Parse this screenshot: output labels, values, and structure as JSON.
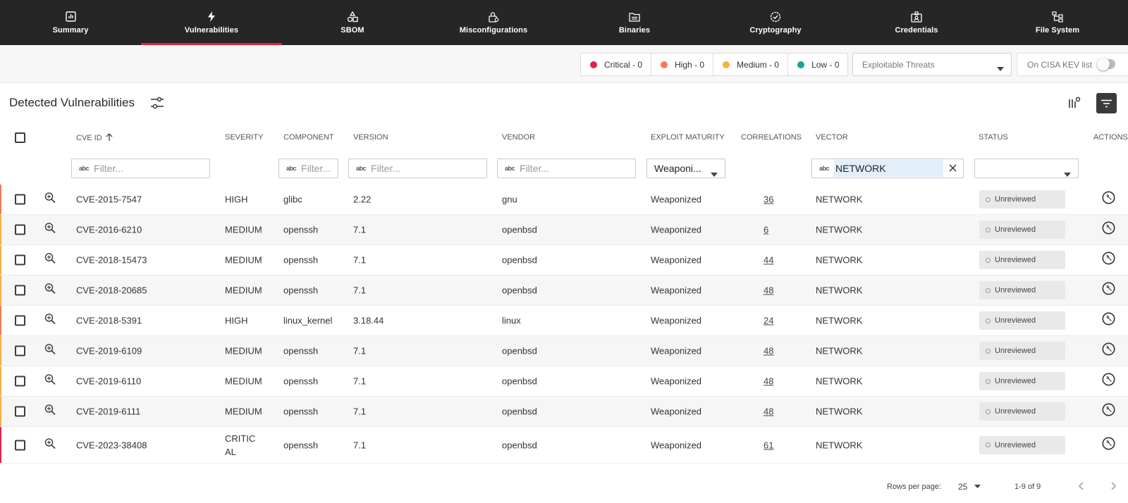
{
  "nav": {
    "tabs": [
      {
        "label": "Summary",
        "icon": "bar-chart-icon",
        "active": false
      },
      {
        "label": "Vulnerabilities",
        "icon": "lightning-icon",
        "active": true
      },
      {
        "label": "SBOM",
        "icon": "shapes-icon",
        "active": false
      },
      {
        "label": "Misconfigurations",
        "icon": "lock-gear-icon",
        "active": false
      },
      {
        "label": "Binaries",
        "icon": "folder-icon",
        "active": false
      },
      {
        "label": "Cryptography",
        "icon": "check-badge-icon",
        "active": false
      },
      {
        "label": "Credentials",
        "icon": "id-card-icon",
        "active": false
      },
      {
        "label": "File System",
        "icon": "tree-icon",
        "active": false
      }
    ],
    "accent_color": "#e8202e"
  },
  "toolbar": {
    "severity": [
      {
        "label": "Critical - 0",
        "color": "#e0234e"
      },
      {
        "label": "High - 0",
        "color": "#f47a5a"
      },
      {
        "label": "Medium - 0",
        "color": "#f6b03e"
      },
      {
        "label": "Low - 0",
        "color": "#17a39a"
      }
    ],
    "threats_placeholder": "Exploitable Threats",
    "kev_label": "On CISA KEV list"
  },
  "section": {
    "title": "Detected Vulnerabilities"
  },
  "table": {
    "headers": {
      "cve_id": "CVE ID",
      "severity": "SEVERITY",
      "component": "COMPONENT",
      "version": "VERSION",
      "vendor": "VENDOR",
      "exploit_maturity": "EXPLOIT MATURITY",
      "correlations": "CORRELATIONS",
      "vector": "VECTOR",
      "status": "STATUS",
      "actions": "ACTIONS"
    },
    "filters": {
      "placeholder": "Filter...",
      "component_placeholder": "Filter...",
      "abc_glyph": "abc",
      "exploit_maturity_value": "Weaponi...",
      "vector_value": "NETWORK",
      "status_value": ""
    },
    "rows": [
      {
        "cve": "CVE-2015-7547",
        "severity": "HIGH",
        "component": "glibc",
        "version": "2.22",
        "vendor": "gnu",
        "exploit": "Weaponized",
        "correlations": "36",
        "vector": "NETWORK",
        "status": "Unreviewed",
        "bar": "#f47a5a"
      },
      {
        "cve": "CVE-2016-6210",
        "severity": "MEDIUM",
        "component": "openssh",
        "version": "7.1",
        "vendor": "openbsd",
        "exploit": "Weaponized",
        "correlations": "6",
        "vector": "NETWORK",
        "status": "Unreviewed",
        "bar": "#f6b03e"
      },
      {
        "cve": "CVE-2018-15473",
        "severity": "MEDIUM",
        "component": "openssh",
        "version": "7.1",
        "vendor": "openbsd",
        "exploit": "Weaponized",
        "correlations": "44",
        "vector": "NETWORK",
        "status": "Unreviewed",
        "bar": "#f6b03e"
      },
      {
        "cve": "CVE-2018-20685",
        "severity": "MEDIUM",
        "component": "openssh",
        "version": "7.1",
        "vendor": "openbsd",
        "exploit": "Weaponized",
        "correlations": "48",
        "vector": "NETWORK",
        "status": "Unreviewed",
        "bar": "#f6b03e"
      },
      {
        "cve": "CVE-2018-5391",
        "severity": "HIGH",
        "component": "linux_kernel",
        "version": "3.18.44",
        "vendor": "linux",
        "exploit": "Weaponized",
        "correlations": "24",
        "vector": "NETWORK",
        "status": "Unreviewed",
        "bar": "#f47a5a"
      },
      {
        "cve": "CVE-2019-6109",
        "severity": "MEDIUM",
        "component": "openssh",
        "version": "7.1",
        "vendor": "openbsd",
        "exploit": "Weaponized",
        "correlations": "48",
        "vector": "NETWORK",
        "status": "Unreviewed",
        "bar": "#f6b03e"
      },
      {
        "cve": "CVE-2019-6110",
        "severity": "MEDIUM",
        "component": "openssh",
        "version": "7.1",
        "vendor": "openbsd",
        "exploit": "Weaponized",
        "correlations": "48",
        "vector": "NETWORK",
        "status": "Unreviewed",
        "bar": "#f6b03e"
      },
      {
        "cve": "CVE-2019-6111",
        "severity": "MEDIUM",
        "component": "openssh",
        "version": "7.1",
        "vendor": "openbsd",
        "exploit": "Weaponized",
        "correlations": "48",
        "vector": "NETWORK",
        "status": "Unreviewed",
        "bar": "#f6b03e"
      },
      {
        "cve": "CVE-2023-38408",
        "severity": "CRITICAL",
        "component": "openssh",
        "version": "7.1",
        "vendor": "openbsd",
        "exploit": "Weaponized",
        "correlations": "61",
        "vector": "NETWORK",
        "status": "Unreviewed",
        "bar": "#e0234e"
      }
    ]
  },
  "footer": {
    "rows_per_page_label": "Rows per page:",
    "rows_per_page_value": "25",
    "range": "1-9 of 9"
  }
}
